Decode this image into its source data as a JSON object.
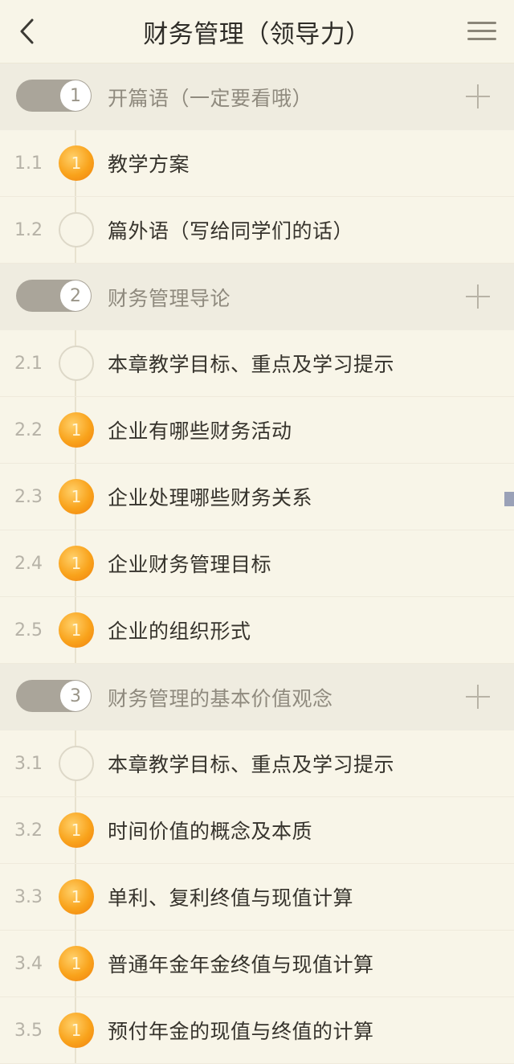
{
  "header": {
    "title": "财务管理（领导力）"
  },
  "chapters": [
    {
      "number": "1",
      "title": "开篇语（一定要看哦）",
      "lessons": [
        {
          "number": "1.1",
          "title": "教学方案",
          "badge": "1",
          "status": "filled"
        },
        {
          "number": "1.2",
          "title": "篇外语（写给同学们的话）",
          "badge": "",
          "status": "empty"
        }
      ]
    },
    {
      "number": "2",
      "title": "财务管理导论",
      "lessons": [
        {
          "number": "2.1",
          "title": "本章教学目标、重点及学习提示",
          "badge": "",
          "status": "empty"
        },
        {
          "number": "2.2",
          "title": "企业有哪些财务活动",
          "badge": "1",
          "status": "filled"
        },
        {
          "number": "2.3",
          "title": "企业处理哪些财务关系",
          "badge": "1",
          "status": "filled"
        },
        {
          "number": "2.4",
          "title": "企业财务管理目标",
          "badge": "1",
          "status": "filled"
        },
        {
          "number": "2.5",
          "title": "企业的组织形式",
          "badge": "1",
          "status": "filled"
        }
      ]
    },
    {
      "number": "3",
      "title": "财务管理的基本价值观念",
      "lessons": [
        {
          "number": "3.1",
          "title": "本章教学目标、重点及学习提示",
          "badge": "",
          "status": "empty"
        },
        {
          "number": "3.2",
          "title": "时间价值的概念及本质",
          "badge": "1",
          "status": "filled"
        },
        {
          "number": "3.3",
          "title": "单利、复利终值与现值计算",
          "badge": "1",
          "status": "filled"
        },
        {
          "number": "3.4",
          "title": "普通年金年金终值与现值计算",
          "badge": "1",
          "status": "filled"
        },
        {
          "number": "3.5",
          "title": "预付年金的现值与终值的计算",
          "badge": "1",
          "status": "filled"
        }
      ]
    }
  ],
  "colors": {
    "background": "#f8f5e8",
    "chapter_background": "#efece0",
    "accent": "#f9a31c"
  },
  "icons": {
    "back": "chevron-left-icon",
    "menu": "hamburger-menu-icon",
    "expand": "plus-icon"
  }
}
